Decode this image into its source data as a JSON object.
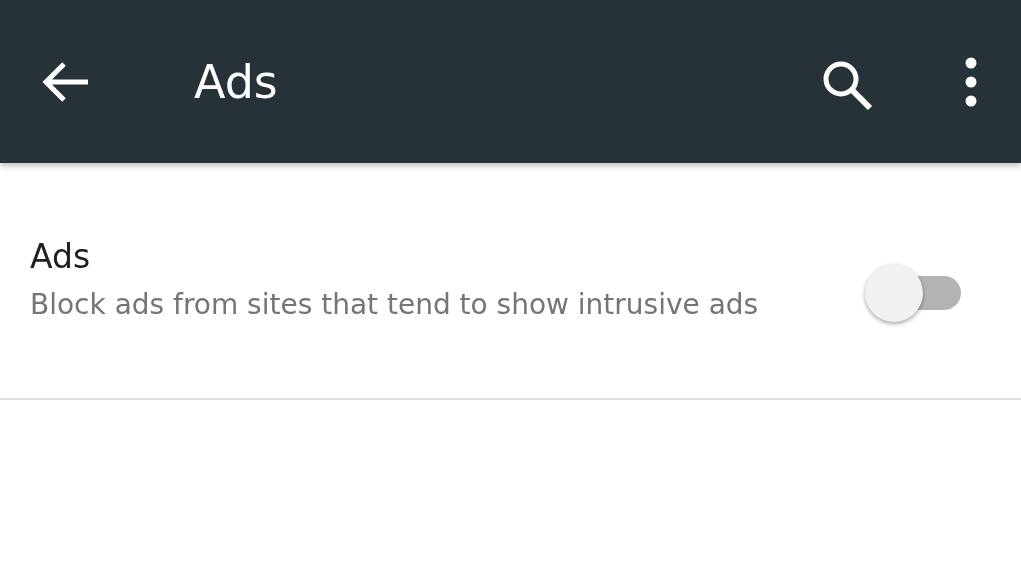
{
  "toolbar": {
    "title": "Ads"
  },
  "settings": [
    {
      "title": "Ads",
      "summary": "Block ads from sites that tend to show intrusive ads",
      "on": false
    }
  ]
}
